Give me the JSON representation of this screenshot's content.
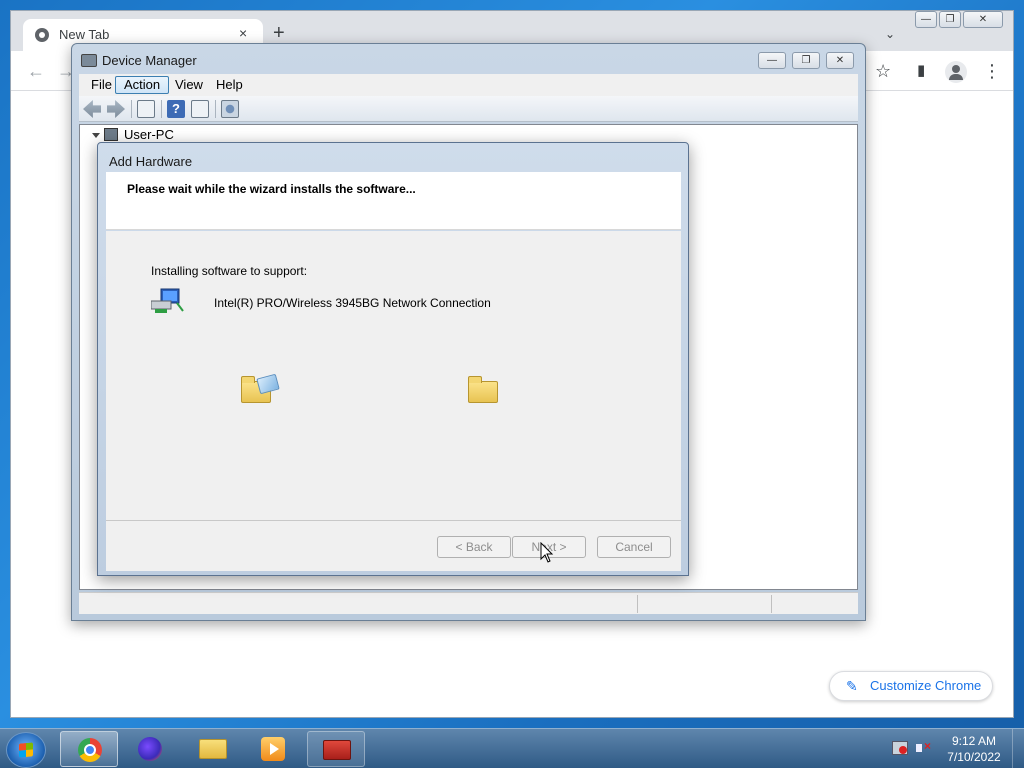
{
  "chrome": {
    "tab_title": "New Tab",
    "tab_close": "×",
    "new_tab": "+",
    "tab_search": "⌄",
    "win_minimize": "—",
    "win_restore": "❐",
    "win_close": "✕",
    "back": "←",
    "forward": "→",
    "bookmark_star": "☆",
    "side_panel": "▮",
    "menu_dots": "⋮",
    "customize_label": "Customize Chrome",
    "customize_icon": "✎"
  },
  "device_manager": {
    "title": "Device Manager",
    "menu": [
      "File",
      "Action",
      "View",
      "Help"
    ],
    "active_menu": "Action",
    "win_minimize": "—",
    "win_restore": "❐",
    "win_close": "✕",
    "tree_root": "User-PC"
  },
  "add_hardware": {
    "title": "Add Hardware",
    "heading": "Please wait while the wizard installs the software...",
    "installing_label": "Installing software to support:",
    "device_name": "Intel(R) PRO/Wireless 3945BG Network Connection",
    "back_label": "< Back",
    "next_label": "Next >",
    "cancel_label": "Cancel"
  },
  "taskbar": {
    "apps": [
      {
        "name": "Google Chrome",
        "icon": "chrome-icon",
        "state": "active"
      },
      {
        "name": "Firefox",
        "icon": "firefox-icon",
        "state": "pinned"
      },
      {
        "name": "Windows Explorer",
        "icon": "folder-icon",
        "state": "pinned"
      },
      {
        "name": "Windows Media Player",
        "icon": "media-player-icon",
        "state": "pinned"
      },
      {
        "name": "Toolbox",
        "icon": "toolbox-icon",
        "state": "running"
      }
    ],
    "clock_time": "9:12 AM",
    "clock_date": "7/10/2022"
  },
  "colors": {
    "desktop_blue": "#1a73c4",
    "chrome_accent": "#1a73e8",
    "taskbar": "#2f5a85"
  }
}
